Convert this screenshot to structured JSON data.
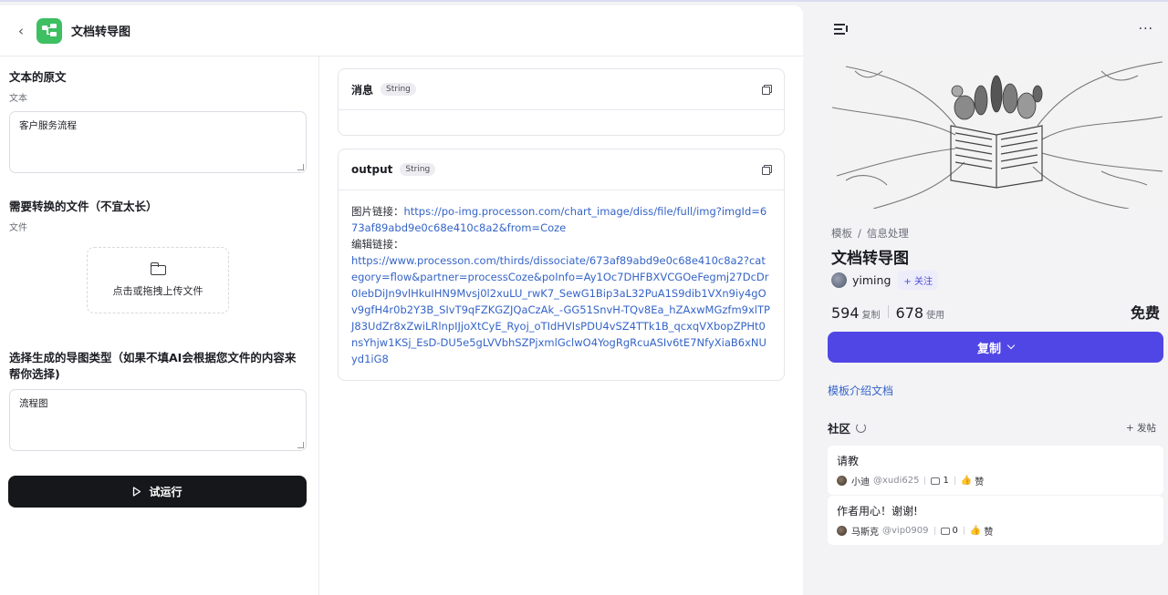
{
  "app": {
    "title": "文档转导图"
  },
  "inputs": [
    {
      "label": "文本的原文",
      "type_label": "文本",
      "value": "客户服务流程"
    },
    {
      "label": "需要转换的文件（不宜太长）",
      "type_label": "文件",
      "upload_text": "点击或拖拽上传文件"
    },
    {
      "label": "选择生成的导图类型（如果不填AI会根据您文件的内容来帮你选择)",
      "value": "流程图"
    }
  ],
  "run_button": "试运行",
  "outputs": {
    "message": {
      "title": "消息",
      "type": "String",
      "value": ""
    },
    "output": {
      "title": "output",
      "type": "String",
      "image_link_label": "图片链接：",
      "image_link": "https://po-img.processon.com/chart_image/diss/file/full/img?imgId=673af89abd9e0c68e410c8a2&from=Coze",
      "edit_link_label": "编辑链接：",
      "edit_link": "https://www.processon.com/thirds/dissociate/673af89abd9e0c68e410c8a2?category=flow&partner=processCoze&poInfo=Ay1Oc7DHFBXVCGOeFegmj27DcDr0IebDiJn9vlHkuIHN9Mvsj0l2xuLU_rwK7_SewG1Bip3aL32PuA1S9dib1VXn9iy4gOv9gfH4r0b2Y3B_SIvT9qFZKGZJQaCzAk_-GG51SnvH-TQv8Ea_hZAxwMGzfm9xlTPJ83UdZr8xZwiLRlnpIJjoXtCyE_Ryoj_oTIdHVIsPDU4vSZ4TTk1B_qcxqVXbopZPHt0nsYhjw1KSj_EsD-DU5e5gLVVbhSZPjxmlGclwO4YogRgRcuASIv6tE7NfyXiaB6xNUyd1iG8"
    }
  },
  "sidebar": {
    "breadcrumb": [
      "模板",
      "信息处理"
    ],
    "template_title": "文档转导图",
    "author": "yiming",
    "follow_label": "+ 关注",
    "copies": "594",
    "copies_label": "复制",
    "uses": "678",
    "uses_label": "使用",
    "price": "免费",
    "copy_button": "复制",
    "intro_link": "模板介绍文档",
    "community_title": "社区",
    "post_button": "+ 发帖",
    "posts": [
      {
        "title": "请教",
        "user": "小迪",
        "handle": "@xudi625",
        "comments": "1",
        "like_label": "赞"
      },
      {
        "title": "作者用心！谢谢!",
        "user": "马斯克",
        "handle": "@vip0909",
        "comments": "0",
        "like_label": "赞"
      }
    ]
  }
}
